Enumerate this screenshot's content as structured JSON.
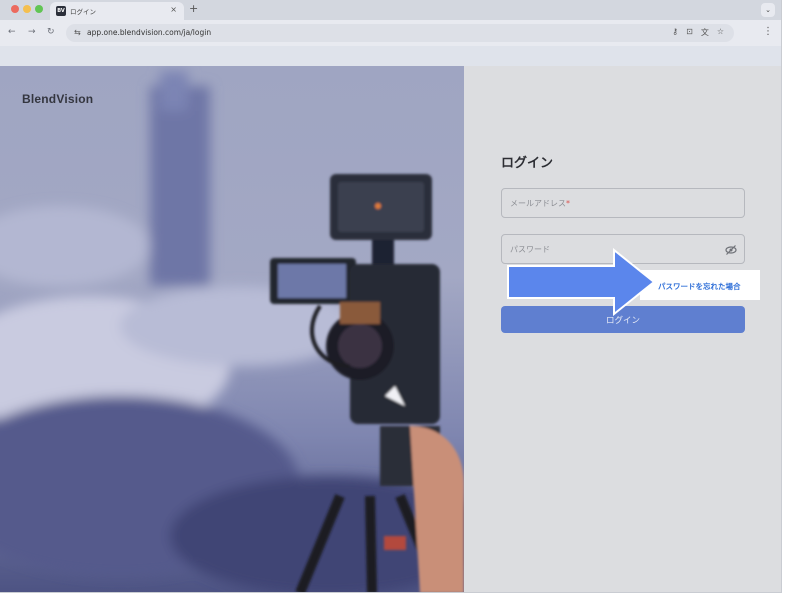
{
  "browser": {
    "tab": {
      "favicon": "BV",
      "title": "ログイン",
      "close_glyph": "×"
    },
    "new_tab_glyph": "+",
    "tab_menu_glyph": "⌄",
    "nav": {
      "back_glyph": "←",
      "forward_glyph": "→",
      "reload_glyph": "↻"
    },
    "site_info_glyph": "⇆",
    "url": "app.one.blendvision.com/ja/login",
    "omni_icons": [
      "key-icon",
      "cast-icon",
      "translate-icon",
      "star-icon"
    ],
    "omni_glyphs": [
      "⚷",
      "⊡",
      "文",
      "☆"
    ],
    "menu_glyph": "⋮"
  },
  "brand": {
    "logo_text": "BlendVision"
  },
  "login": {
    "title": "ログイン",
    "email_label": "メールアドレス",
    "required_mark": "*",
    "password_label": "パスワード",
    "forgot_link": "パスワードを忘れた場合",
    "submit_label": "ログイン"
  },
  "annotation": {
    "arrow_color": "#5b86ec",
    "arrow_outline": "#ffffff"
  },
  "colors": {
    "link": "#2f6fd8",
    "button": "#5f7fd0",
    "overlay": "#dcdde0"
  }
}
